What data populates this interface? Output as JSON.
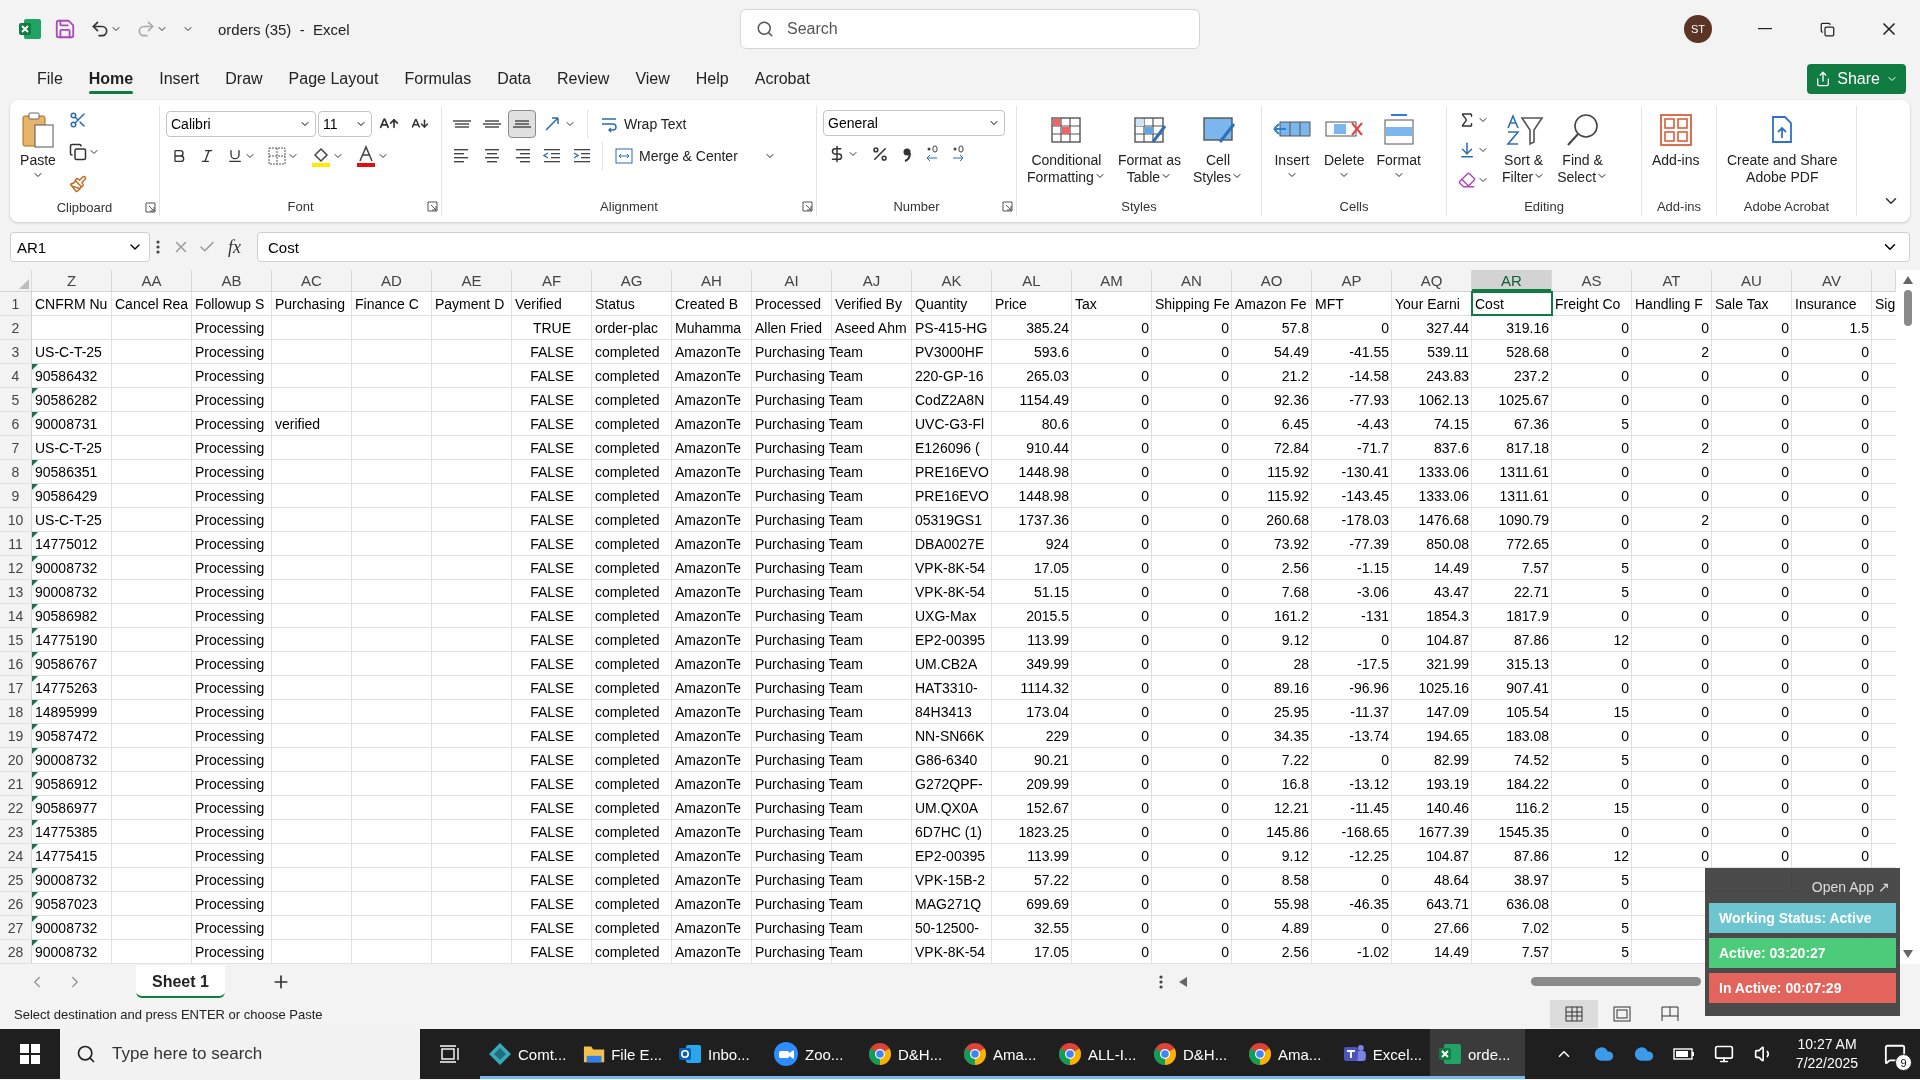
{
  "title_bar": {
    "document_title": "orders (35)  -  Excel",
    "search_placeholder": "Search",
    "user_initials": "ST"
  },
  "menu_tabs": [
    {
      "label": "File",
      "selected": false
    },
    {
      "label": "Home",
      "selected": true
    },
    {
      "label": "Insert",
      "selected": false
    },
    {
      "label": "Draw",
      "selected": false
    },
    {
      "label": "Page Layout",
      "selected": false
    },
    {
      "label": "Formulas",
      "selected": false
    },
    {
      "label": "Data",
      "selected": false
    },
    {
      "label": "Review",
      "selected": false
    },
    {
      "label": "View",
      "selected": false
    },
    {
      "label": "Help",
      "selected": false
    },
    {
      "label": "Acrobat",
      "selected": false
    }
  ],
  "share_button": "Share",
  "ribbon_groups": [
    {
      "kind": "clipboard",
      "name": "Clipboard",
      "buttons": [
        {
          "lines": [
            "Paste"
          ]
        }
      ]
    },
    {
      "kind": "font",
      "name": "Font",
      "font": "Calibri",
      "size": "11"
    },
    {
      "kind": "alignment",
      "name": "Alignment",
      "wrap": "Wrap Text",
      "merge": "Merge & Center",
      "vertical": [
        {
          "kind": "top",
          "selected": false
        },
        {
          "kind": "middle",
          "selected": false
        },
        {
          "kind": "bottom",
          "selected": true
        }
      ]
    },
    {
      "kind": "number",
      "name": "Number",
      "format": "General"
    },
    {
      "kind": "styles",
      "name": "Styles",
      "buttons": [
        {
          "lines": [
            "Conditional",
            "Formatting"
          ]
        },
        {
          "lines": [
            "Format as",
            "Table"
          ]
        },
        {
          "lines": [
            "Cell",
            "Styles"
          ]
        }
      ]
    },
    {
      "kind": "cells",
      "name": "Cells",
      "buttons": [
        {
          "lines": [
            "Insert"
          ]
        },
        {
          "lines": [
            "Delete"
          ]
        },
        {
          "lines": [
            "Format"
          ]
        }
      ]
    },
    {
      "kind": "editing",
      "name": "Editing",
      "buttons": [
        {
          "lines": [
            "Sort &",
            "Filter"
          ]
        },
        {
          "lines": [
            "Find &",
            "Select"
          ]
        }
      ]
    },
    {
      "kind": "addins",
      "name": "Add-ins",
      "buttons": [
        {
          "lines": [
            "Add-ins"
          ]
        }
      ]
    },
    {
      "kind": "acrobat",
      "name": "Adobe Acrobat",
      "buttons": [
        {
          "lines": [
            "Create and Share",
            "Adobe PDF"
          ]
        }
      ]
    }
  ],
  "formula_bar": {
    "name_box": "AR1",
    "function_button": "fx",
    "formula": "Cost"
  },
  "columns": [
    {
      "letter": "Z",
      "kind": "text",
      "selected": false
    },
    {
      "letter": "AA",
      "kind": "text",
      "selected": false
    },
    {
      "letter": "AB",
      "kind": "text",
      "selected": false
    },
    {
      "letter": "AC",
      "kind": "text",
      "selected": false
    },
    {
      "letter": "AD",
      "kind": "text",
      "selected": false
    },
    {
      "letter": "AE",
      "kind": "text",
      "selected": false
    },
    {
      "letter": "AF",
      "kind": "boolean",
      "selected": false
    },
    {
      "letter": "AG",
      "kind": "text",
      "selected": false
    },
    {
      "letter": "AH",
      "kind": "text",
      "selected": false
    },
    {
      "letter": "AI",
      "kind": "text",
      "selected": false
    },
    {
      "letter": "AJ",
      "kind": "text",
      "selected": false
    },
    {
      "letter": "AK",
      "kind": "text",
      "selected": false
    },
    {
      "letter": "AL",
      "kind": "number",
      "selected": false
    },
    {
      "letter": "AM",
      "kind": "number",
      "selected": false
    },
    {
      "letter": "AN",
      "kind": "number",
      "selected": false
    },
    {
      "letter": "AO",
      "kind": "number",
      "selected": false
    },
    {
      "letter": "AP",
      "kind": "number",
      "selected": false
    },
    {
      "letter": "AQ",
      "kind": "number",
      "selected": false
    },
    {
      "letter": "AR",
      "kind": "number",
      "selected": true
    },
    {
      "letter": "AS",
      "kind": "number",
      "selected": false
    },
    {
      "letter": "AT",
      "kind": "number",
      "selected": false
    },
    {
      "letter": "AU",
      "kind": "number",
      "selected": false
    },
    {
      "letter": "AV",
      "kind": "number",
      "selected": false
    },
    {
      "kind": "text",
      "selected": false
    }
  ],
  "rows": [
    {
      "number": "1",
      "selected": true,
      "flagged": false,
      "cells": [
        "CNFRM Nu",
        "Cancel Rea",
        "Followup S",
        "Purchasing",
        "Finance C",
        "Payment D",
        "Verified",
        "Status",
        "Created B",
        "Processed",
        "Verified By",
        "Quantity",
        "Price",
        "Tax",
        "Shipping Fe",
        "Amazon Fe",
        "MFT",
        "Your Earni",
        "Cost",
        "Freight Co",
        "Handling F",
        "Sale Tax",
        "Insurance",
        "Sig"
      ]
    },
    {
      "number": "2",
      "selected": false,
      "flagged": false,
      "cells": [
        null,
        null,
        "Processing",
        null,
        null,
        null,
        "TRUE",
        "order-plac",
        "Muhamma",
        "Allen Fried",
        "Aseed Ahm",
        "PS-415-HG",
        "385.24",
        "0",
        "0",
        "57.8",
        "0",
        "327.44",
        "319.16",
        "0",
        "0",
        "0",
        "1.5"
      ]
    },
    {
      "number": "3",
      "selected": false,
      "flagged": false,
      "cells": [
        "US-C-T-25",
        null,
        "Processing",
        null,
        null,
        null,
        "FALSE",
        "completed",
        "AmazonTe",
        "Purchasing Team",
        null,
        "PV3000HF",
        "593.6",
        "0",
        "0",
        "54.49",
        "-41.55",
        "539.11",
        "528.68",
        "0",
        "2",
        "0",
        "0"
      ]
    },
    {
      "number": "4",
      "selected": false,
      "flagged": true,
      "cells": [
        "90586432",
        null,
        "Processing",
        null,
        null,
        null,
        "FALSE",
        "completed",
        "AmazonTe",
        "Purchasing Team",
        null,
        "220-GP-16",
        "265.03",
        "0",
        "0",
        "21.2",
        "-14.58",
        "243.83",
        "237.2",
        "0",
        "0",
        "0",
        "0"
      ]
    },
    {
      "number": "5",
      "selected": false,
      "flagged": true,
      "cells": [
        "90586282",
        null,
        "Processing",
        null,
        null,
        null,
        "FALSE",
        "completed",
        "AmazonTe",
        "Purchasing Team",
        null,
        "CodZ2A8N",
        "1154.49",
        "0",
        "0",
        "92.36",
        "-77.93",
        "1062.13",
        "1025.67",
        "0",
        "0",
        "0",
        "0"
      ]
    },
    {
      "number": "6",
      "selected": false,
      "flagged": true,
      "cells": [
        "90008731",
        null,
        "Processing",
        "verified",
        null,
        null,
        "FALSE",
        "completed",
        "AmazonTe",
        "Purchasing Team",
        null,
        "UVC-G3-Fl",
        "80.6",
        "0",
        "0",
        "6.45",
        "-4.43",
        "74.15",
        "67.36",
        "5",
        "0",
        "0",
        "0"
      ]
    },
    {
      "number": "7",
      "selected": false,
      "flagged": false,
      "cells": [
        "US-C-T-25",
        null,
        "Processing",
        null,
        null,
        null,
        "FALSE",
        "completed",
        "AmazonTe",
        "Purchasing Team",
        null,
        "E126096 (",
        "910.44",
        "0",
        "0",
        "72.84",
        "-71.7",
        "837.6",
        "817.18",
        "0",
        "2",
        "0",
        "0"
      ]
    },
    {
      "number": "8",
      "selected": false,
      "flagged": true,
      "cells": [
        "90586351",
        null,
        "Processing",
        null,
        null,
        null,
        "FALSE",
        "completed",
        "AmazonTe",
        "Purchasing Team",
        null,
        "PRE16EVO",
        "1448.98",
        "0",
        "0",
        "115.92",
        "-130.41",
        "1333.06",
        "1311.61",
        "0",
        "0",
        "0",
        "0"
      ]
    },
    {
      "number": "9",
      "selected": false,
      "flagged": true,
      "cells": [
        "90586429",
        null,
        "Processing",
        null,
        null,
        null,
        "FALSE",
        "completed",
        "AmazonTe",
        "Purchasing Team",
        null,
        "PRE16EVO",
        "1448.98",
        "0",
        "0",
        "115.92",
        "-143.45",
        "1333.06",
        "1311.61",
        "0",
        "0",
        "0",
        "0"
      ]
    },
    {
      "number": "10",
      "selected": false,
      "flagged": false,
      "cells": [
        "US-C-T-25",
        null,
        "Processing",
        null,
        null,
        null,
        "FALSE",
        "completed",
        "AmazonTe",
        "Purchasing Team",
        null,
        "05319GS1",
        "1737.36",
        "0",
        "0",
        "260.68",
        "-178.03",
        "1476.68",
        "1090.79",
        "0",
        "2",
        "0",
        "0"
      ]
    },
    {
      "number": "11",
      "selected": false,
      "flagged": true,
      "cells": [
        "14775012",
        null,
        "Processing",
        null,
        null,
        null,
        "FALSE",
        "completed",
        "AmazonTe",
        "Purchasing Team",
        null,
        "DBA0027E",
        "924",
        "0",
        "0",
        "73.92",
        "-77.39",
        "850.08",
        "772.65",
        "0",
        "0",
        "0",
        "0"
      ]
    },
    {
      "number": "12",
      "selected": false,
      "flagged": true,
      "cells": [
        "90008732",
        null,
        "Processing",
        null,
        null,
        null,
        "FALSE",
        "completed",
        "AmazonTe",
        "Purchasing Team",
        null,
        "VPK-8K-54",
        "17.05",
        "0",
        "0",
        "2.56",
        "-1.15",
        "14.49",
        "7.57",
        "5",
        "0",
        "0",
        "0"
      ]
    },
    {
      "number": "13",
      "selected": false,
      "flagged": true,
      "cells": [
        "90008732",
        null,
        "Processing",
        null,
        null,
        null,
        "FALSE",
        "completed",
        "AmazonTe",
        "Purchasing Team",
        null,
        "VPK-8K-54",
        "51.15",
        "0",
        "0",
        "7.68",
        "-3.06",
        "43.47",
        "22.71",
        "5",
        "0",
        "0",
        "0"
      ]
    },
    {
      "number": "14",
      "selected": false,
      "flagged": true,
      "cells": [
        "90586982",
        null,
        "Processing",
        null,
        null,
        null,
        "FALSE",
        "completed",
        "AmazonTe",
        "Purchasing Team",
        null,
        "UXG-Max",
        "2015.5",
        "0",
        "0",
        "161.2",
        "-131",
        "1854.3",
        "1817.9",
        "0",
        "0",
        "0",
        "0"
      ]
    },
    {
      "number": "15",
      "selected": false,
      "flagged": true,
      "cells": [
        "14775190",
        null,
        "Processing",
        null,
        null,
        null,
        "FALSE",
        "completed",
        "AmazonTe",
        "Purchasing Team",
        null,
        "EP2-00395",
        "113.99",
        "0",
        "0",
        "9.12",
        "0",
        "104.87",
        "87.86",
        "12",
        "0",
        "0",
        "0"
      ]
    },
    {
      "number": "16",
      "selected": false,
      "flagged": true,
      "cells": [
        "90586767",
        null,
        "Processing",
        null,
        null,
        null,
        "FALSE",
        "completed",
        "AmazonTe",
        "Purchasing Team",
        null,
        "UM.CB2A",
        "349.99",
        "0",
        "0",
        "28",
        "-17.5",
        "321.99",
        "315.13",
        "0",
        "0",
        "0",
        "0"
      ]
    },
    {
      "number": "17",
      "selected": false,
      "flagged": true,
      "cells": [
        "14775263",
        null,
        "Processing",
        null,
        null,
        null,
        "FALSE",
        "completed",
        "AmazonTe",
        "Purchasing Team",
        null,
        "HAT3310-",
        "1114.32",
        "0",
        "0",
        "89.16",
        "-96.96",
        "1025.16",
        "907.41",
        "0",
        "0",
        "0",
        "0"
      ]
    },
    {
      "number": "18",
      "selected": false,
      "flagged": true,
      "cells": [
        "14895999",
        null,
        "Processing",
        null,
        null,
        null,
        "FALSE",
        "completed",
        "AmazonTe",
        "Purchasing Team",
        null,
        "84H3413",
        "173.04",
        "0",
        "0",
        "25.95",
        "-11.37",
        "147.09",
        "105.54",
        "15",
        "0",
        "0",
        "0"
      ]
    },
    {
      "number": "19",
      "selected": false,
      "flagged": true,
      "cells": [
        "90587472",
        null,
        "Processing",
        null,
        null,
        null,
        "FALSE",
        "completed",
        "AmazonTe",
        "Purchasing Team",
        null,
        "NN-SN66K",
        "229",
        "0",
        "0",
        "34.35",
        "-13.74",
        "194.65",
        "183.08",
        "0",
        "0",
        "0",
        "0"
      ]
    },
    {
      "number": "20",
      "selected": false,
      "flagged": true,
      "cells": [
        "90008732",
        null,
        "Processing",
        null,
        null,
        null,
        "FALSE",
        "completed",
        "AmazonTe",
        "Purchasing Team",
        null,
        "G86-6340",
        "90.21",
        "0",
        "0",
        "7.22",
        "0",
        "82.99",
        "74.52",
        "5",
        "0",
        "0",
        "0"
      ]
    },
    {
      "number": "21",
      "selected": false,
      "flagged": true,
      "cells": [
        "90586912",
        null,
        "Processing",
        null,
        null,
        null,
        "FALSE",
        "completed",
        "AmazonTe",
        "Purchasing Team",
        null,
        "G272QPF-",
        "209.99",
        "0",
        "0",
        "16.8",
        "-13.12",
        "193.19",
        "184.22",
        "0",
        "0",
        "0",
        "0"
      ]
    },
    {
      "number": "22",
      "selected": false,
      "flagged": true,
      "cells": [
        "90586977",
        null,
        "Processing",
        null,
        null,
        null,
        "FALSE",
        "completed",
        "AmazonTe",
        "Purchasing Team",
        null,
        "UM.QX0A",
        "152.67",
        "0",
        "0",
        "12.21",
        "-11.45",
        "140.46",
        "116.2",
        "15",
        "0",
        "0",
        "0"
      ]
    },
    {
      "number": "23",
      "selected": false,
      "flagged": true,
      "cells": [
        "14775385",
        null,
        "Processing",
        null,
        null,
        null,
        "FALSE",
        "completed",
        "AmazonTe",
        "Purchasing Team",
        null,
        "6D7HC (1)",
        "1823.25",
        "0",
        "0",
        "145.86",
        "-168.65",
        "1677.39",
        "1545.35",
        "0",
        "0",
        "0",
        "0"
      ]
    },
    {
      "number": "24",
      "selected": false,
      "flagged": true,
      "cells": [
        "14775415",
        null,
        "Processing",
        null,
        null,
        null,
        "FALSE",
        "completed",
        "AmazonTe",
        "Purchasing Team",
        null,
        "EP2-00395",
        "113.99",
        "0",
        "0",
        "9.12",
        "-12.25",
        "104.87",
        "87.86",
        "12",
        "0",
        "0",
        "0"
      ]
    },
    {
      "number": "25",
      "selected": false,
      "flagged": true,
      "cells": [
        "90008732",
        null,
        "Processing",
        null,
        null,
        null,
        "FALSE",
        "completed",
        "AmazonTe",
        "Purchasing Team",
        null,
        "VPK-15B-2",
        "57.22",
        "0",
        "0",
        "8.58",
        "0",
        "48.64",
        "38.97",
        "5"
      ]
    },
    {
      "number": "26",
      "selected": false,
      "flagged": true,
      "cells": [
        "90587023",
        null,
        "Processing",
        null,
        null,
        null,
        "FALSE",
        "completed",
        "AmazonTe",
        "Purchasing Team",
        null,
        "MAG271Q",
        "699.69",
        "0",
        "0",
        "55.98",
        "-46.35",
        "643.71",
        "636.08",
        "0"
      ]
    },
    {
      "number": "27",
      "selected": false,
      "flagged": true,
      "cells": [
        "90008732",
        null,
        "Processing",
        null,
        null,
        null,
        "FALSE",
        "completed",
        "AmazonTe",
        "Purchasing Team",
        null,
        "50-12500-",
        "32.55",
        "0",
        "0",
        "4.89",
        "0",
        "27.66",
        "7.02",
        "5"
      ]
    },
    {
      "number": "28",
      "selected": false,
      "flagged": true,
      "cells": [
        "90008732",
        null,
        "Processing",
        null,
        null,
        null,
        "FALSE",
        "completed",
        "AmazonTe",
        "Purchasing Team",
        null,
        "VPK-8K-54",
        "17.05",
        "0",
        "0",
        "2.56",
        "-1.02",
        "14.49",
        "7.57",
        "5"
      ]
    }
  ],
  "sheet_tabs": [
    {
      "label": "Sheet 1",
      "selected": true
    }
  ],
  "status_bar": {
    "message": "Select destination and press ENTER or choose Paste",
    "views": [
      {
        "kind": "normal",
        "selected": true
      },
      {
        "kind": "page-layout",
        "selected": false
      },
      {
        "kind": "page-break",
        "selected": false
      }
    ]
  },
  "timer_panel": {
    "open_app": "Open App ↗",
    "statuses": [
      {
        "label": "Working Status: Active",
        "color": "#6cc5cf"
      },
      {
        "label": "Active: 03:20:27",
        "color": "#4ccb7a"
      },
      {
        "label": "In Active: 00:07:29",
        "color": "#e2645c"
      }
    ]
  },
  "taskbar": {
    "search_placeholder": "Type here to search",
    "apps": [
      {
        "kind": "comet",
        "label": "Comt...",
        "selected": false
      },
      {
        "kind": "folder",
        "label": "File E...",
        "selected": false
      },
      {
        "kind": "outlook",
        "label": "Inbo...",
        "selected": false
      },
      {
        "kind": "zoom",
        "label": "Zoo...",
        "selected": false
      },
      {
        "kind": "chrome",
        "label": "D&H...",
        "selected": false
      },
      {
        "kind": "chrome",
        "label": "Ama...",
        "selected": false
      },
      {
        "kind": "chrome",
        "label": "ALL-I...",
        "selected": false
      },
      {
        "kind": "chrome",
        "label": "D&H...",
        "selected": false
      },
      {
        "kind": "chrome",
        "label": "Ama...",
        "selected": false
      },
      {
        "kind": "teams",
        "label": "Excel...",
        "selected": false
      },
      {
        "kind": "excel",
        "label": "orde...",
        "selected": true
      }
    ],
    "time": "10:27 AM",
    "date": "7/22/2025",
    "notifications": "9"
  }
}
